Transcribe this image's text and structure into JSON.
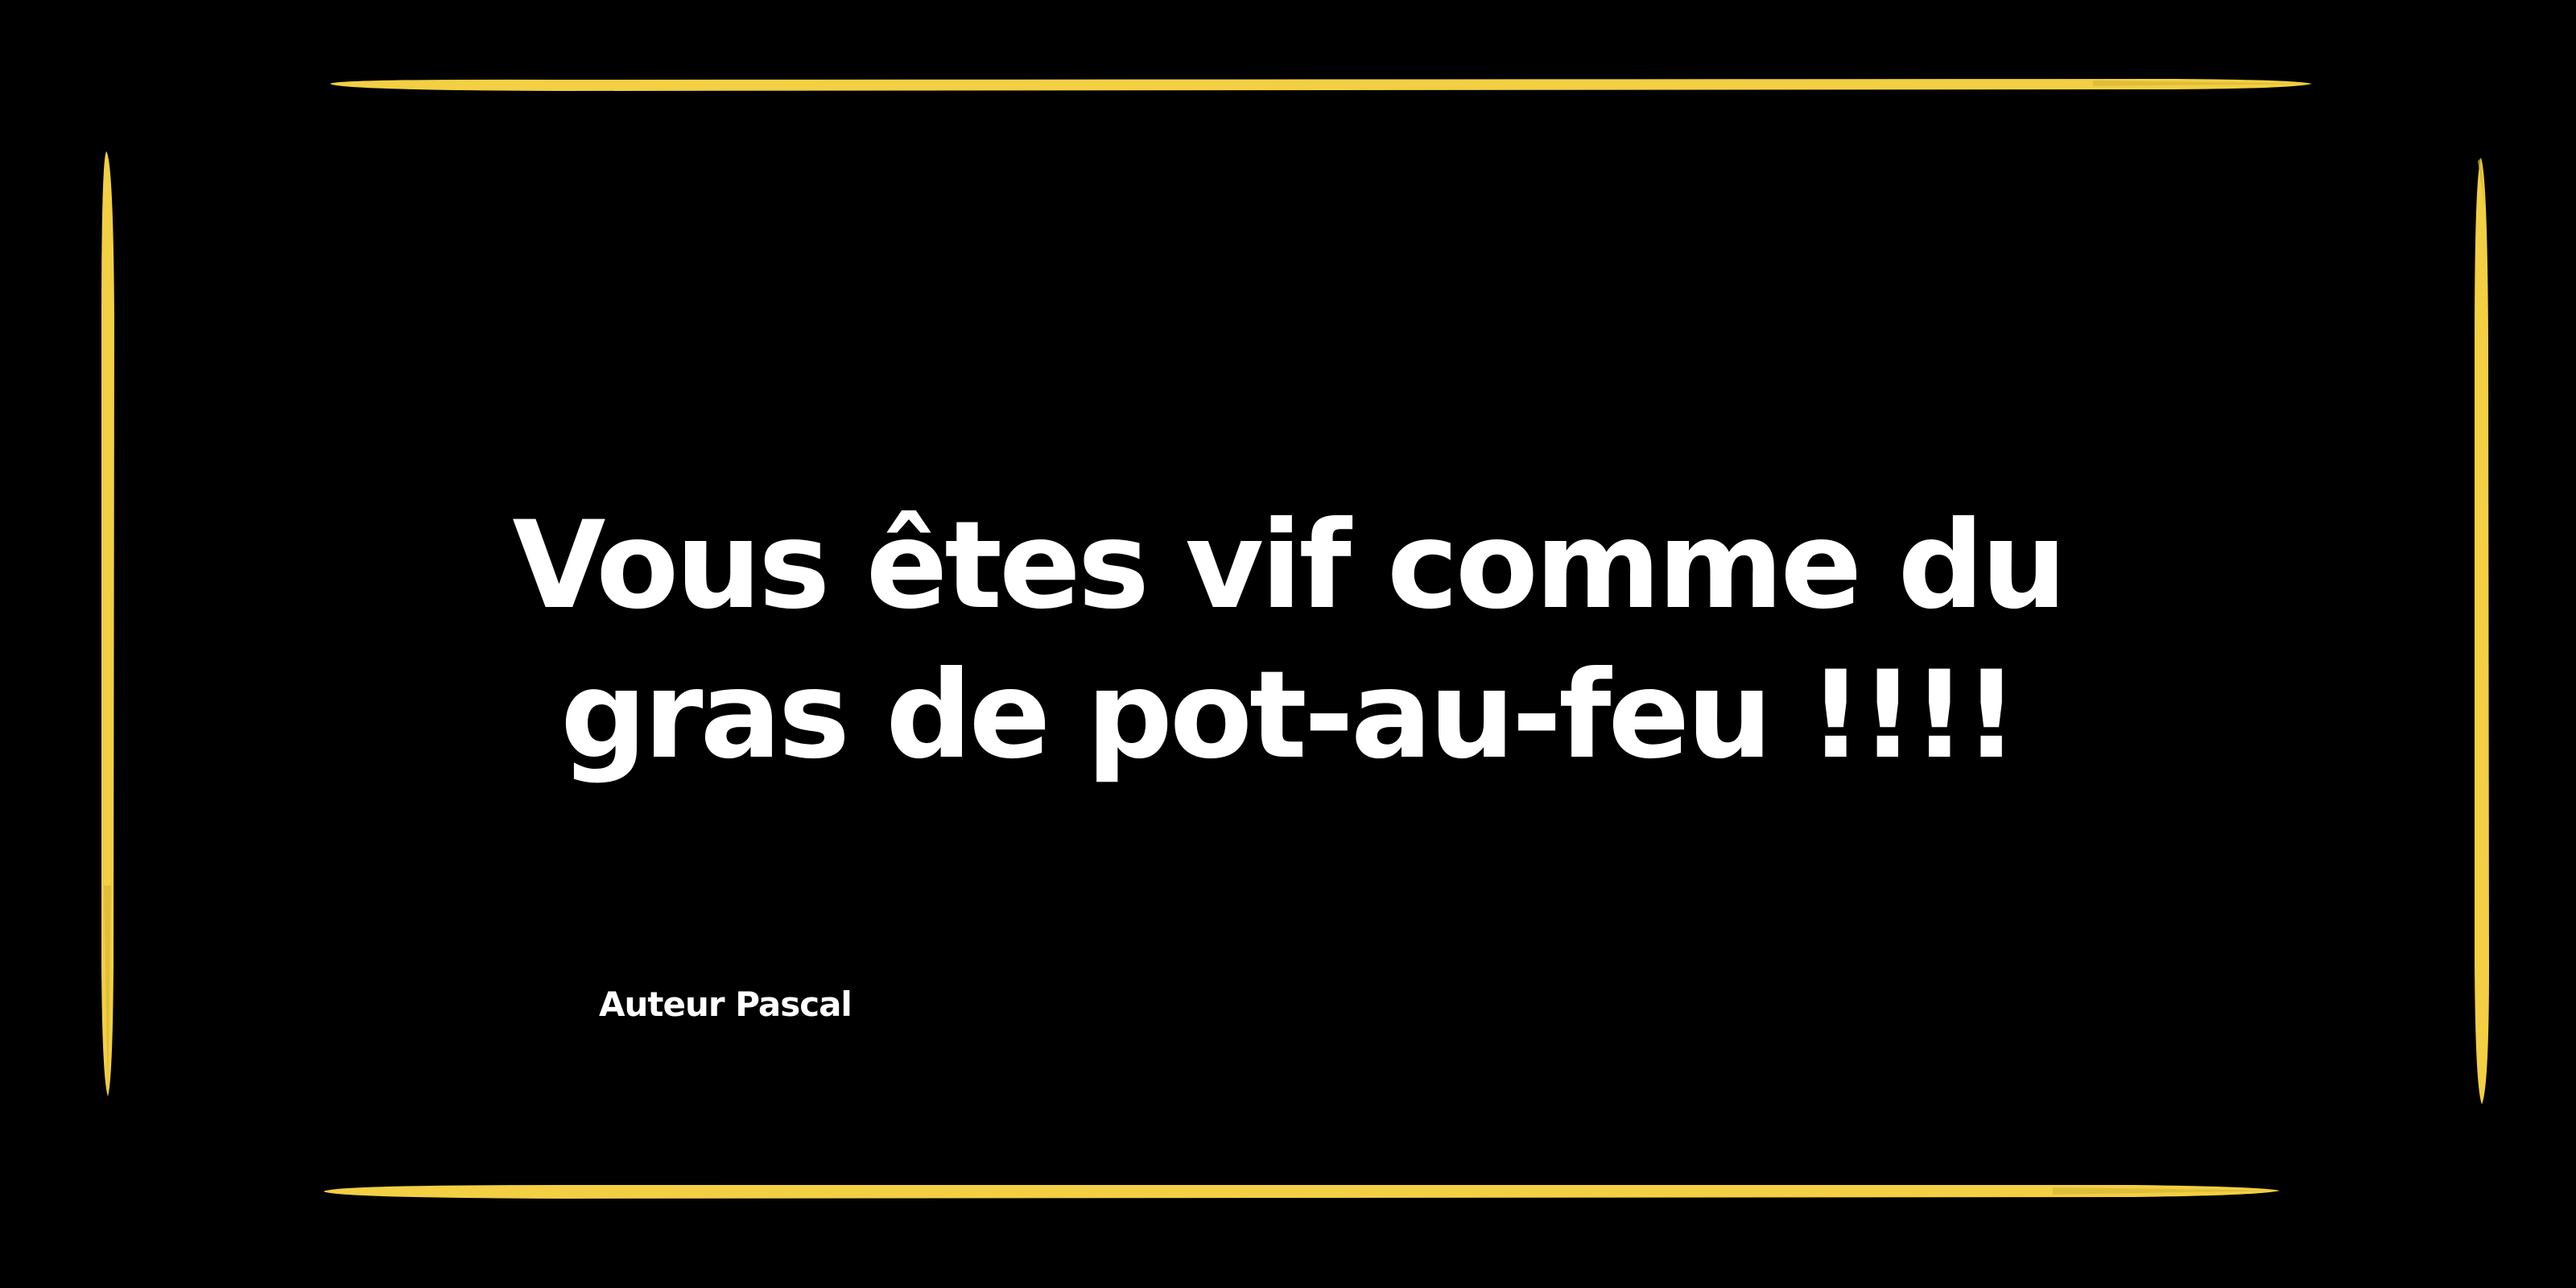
{
  "card": {
    "background_color": "#000000",
    "frame_color": "#f2cf43",
    "quote": "Vous êtes vif comme du gras de pot-au-feu !!!!",
    "author": "Auteur Pascal",
    "text_color": "#ffffff"
  }
}
